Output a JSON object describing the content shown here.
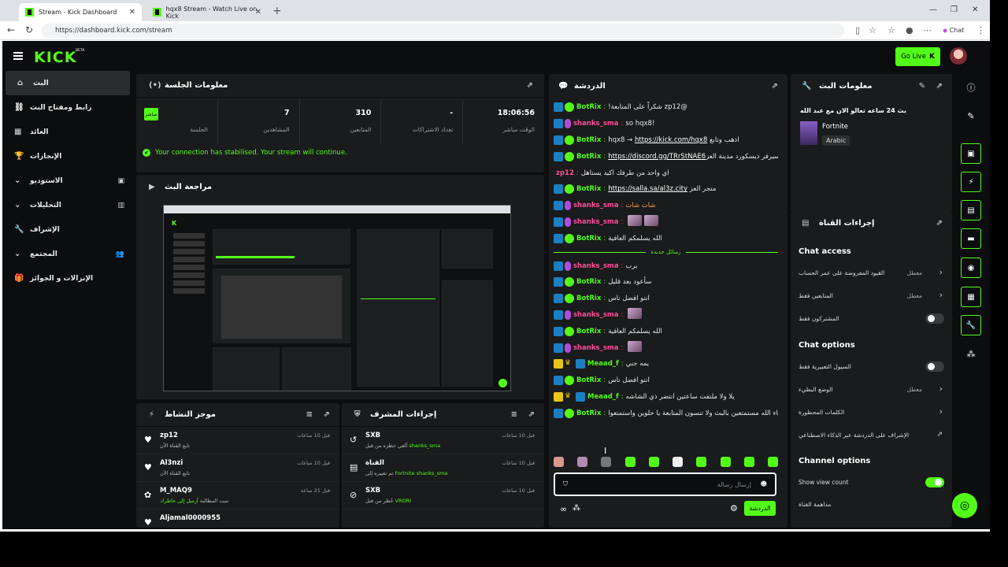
{
  "browser": {
    "tabs": [
      {
        "title": "Stream - Kick Dashboard",
        "active": true
      },
      {
        "title": "hqx8 Stream - Watch Live on Kick",
        "active": false
      }
    ],
    "url": "https://dashboard.kick.com/stream",
    "chat_label": "Chat"
  },
  "app": {
    "logo": "KICK",
    "logo_badge": "BETA",
    "go_live": "Go Live"
  },
  "sidebar": {
    "items": [
      {
        "label": "البث",
        "icon": "house-icon",
        "active": true
      },
      {
        "label": "رابط ومفتاح البث",
        "icon": "link-icon"
      },
      {
        "label": "العائد",
        "icon": "chart-icon"
      },
      {
        "label": "الإنجازات",
        "icon": "trophy-icon"
      },
      {
        "label": "الاستوديو",
        "icon": "studio-icon",
        "expandable": true
      },
      {
        "label": "التحليلات",
        "icon": "analytics-icon",
        "expandable": true
      },
      {
        "label": "الإشراف",
        "icon": "wrench-icon"
      },
      {
        "label": "المجتمع",
        "icon": "community-icon",
        "expandable": true
      },
      {
        "label": "الإنزالات و الجوائز",
        "icon": "gift-icon"
      }
    ]
  },
  "session": {
    "title": "معلومات الجلسة",
    "live_badge": "مباشر",
    "stats": [
      {
        "value": "",
        "label": "الجلسة"
      },
      {
        "value": "7",
        "label": "المشاهدين"
      },
      {
        "value": "310",
        "label": "المتابعين"
      },
      {
        "value": "-",
        "label": "تعداد الاشتراكات"
      },
      {
        "value": "18:06:56",
        "label": "الوقت مباشر"
      }
    ],
    "status_message": "Your connection has stabilised. Your stream will continue."
  },
  "preview": {
    "title": "مراجعة البث"
  },
  "activity": {
    "title": "موجز النشاط",
    "rows": [
      {
        "name": "zp12",
        "sub": "تابع القناة الآن",
        "time": "قبل 10 ساعات",
        "icon": "heart-icon"
      },
      {
        "name": "Al3nzi",
        "sub": "تابع القناة الآن",
        "time": "قبل 10 ساعات",
        "icon": "heart-icon"
      },
      {
        "name": "M_MAQ9",
        "sub": "أرسل إلى خاطرك",
        "time": "قبل 21 ساعة",
        "icon": "gift-icon",
        "sub_prefix": "تمت المطالبة"
      },
      {
        "name": "Aljamal0000955",
        "sub": "",
        "time": "",
        "icon": "heart-icon"
      }
    ]
  },
  "modlog": {
    "title": "إجراءات المشرف",
    "rows": [
      {
        "name": "SXB",
        "sub_user": "shanks_sma",
        "sub": "ألغي حظره من قبل",
        "time": "قبل 10 ساعات",
        "icon": "undo-icon"
      },
      {
        "name": "القناة",
        "sub_user": "shanks_sma",
        "sub_mid": "Fortnite",
        "sub": "تم تغييره إلى",
        "time": "قبل 10 ساعات",
        "icon": "channel-icon"
      },
      {
        "name": "SXB",
        "sub_user": "VRORI",
        "sub": "حُظر من قبل",
        "time": "قبل 10 ساعات",
        "icon": "ban-icon"
      }
    ]
  },
  "chat": {
    "title": "الدردشة",
    "new_messages_label": "رسائل جديدة",
    "messages": [
      {
        "user": "BotRix",
        "color": "green",
        "badges": [
          "bot",
          "ver"
        ],
        "text": "@zp12 شكراً على المتابعة!"
      },
      {
        "user": "shanks_sma",
        "color": "pink",
        "badges": [
          "bot",
          "mic"
        ],
        "text": "!so hqx8"
      },
      {
        "user": "BotRix",
        "color": "green",
        "badges": [
          "bot",
          "ver"
        ],
        "text": "اذهب وتابع hqx8 → ",
        "link": "https://kick.com/hqx8"
      },
      {
        "user": "BotRix",
        "color": "green",
        "badges": [
          "bot",
          "ver"
        ],
        "text": " سيرفر ديسكورد مدينة العز",
        "link": "https://discord.gg/TRrStNAE6"
      },
      {
        "user": "zp12",
        "color": "pink",
        "badges": [],
        "text": "اي واحد من طرفك اكيد يستاهل"
      },
      {
        "user": "BotRix",
        "color": "green",
        "badges": [
          "bot",
          "ver"
        ],
        "text": "متجر العز ",
        "link": "https://salla.sa/al3z.city"
      },
      {
        "user": "shanks_sma",
        "color": "pink",
        "badges": [
          "bot",
          "mic"
        ],
        "text": "شات شات",
        "orange": true
      },
      {
        "user": "shanks_sma",
        "color": "pink",
        "badges": [
          "bot",
          "mic"
        ],
        "text": "",
        "emotes": 2
      },
      {
        "user": "BotRix",
        "color": "green",
        "badges": [
          "bot",
          "ver"
        ],
        "text": "الله يسلمكم العافية"
      },
      {
        "divider": true
      },
      {
        "user": "shanks_sma",
        "color": "pink",
        "badges": [
          "bot",
          "mic"
        ],
        "text": "برب"
      },
      {
        "user": "BotRix",
        "color": "green",
        "badges": [
          "bot",
          "ver"
        ],
        "text": "سأعود بعد قليل"
      },
      {
        "user": "BotRix",
        "color": "green",
        "badges": [
          "bot",
          "ver"
        ],
        "text": "انتو افضل ناس"
      },
      {
        "user": "shanks_sma",
        "color": "pink",
        "badges": [
          "bot",
          "mic"
        ],
        "text": "",
        "emotes": 1
      },
      {
        "user": "BotRix",
        "color": "green",
        "badges": [
          "bot",
          "ver"
        ],
        "text": "الله يسلمكم العافية"
      },
      {
        "user": "shanks_sma",
        "color": "pink",
        "badges": [
          "bot",
          "mic"
        ],
        "text": "",
        "emotes": 1
      },
      {
        "user": "Meaad_f",
        "color": "green",
        "badges": [
          "sub",
          "crown",
          "bot"
        ],
        "text": "يمه جني"
      },
      {
        "user": "BotRix",
        "color": "green",
        "badges": [
          "bot",
          "ver"
        ],
        "text": "انتو افضل ناس"
      },
      {
        "user": "Meaad_f",
        "color": "green",
        "badges": [
          "sub",
          "crown",
          "bot"
        ],
        "text": "يلا ولا ملتفت ساعتين انتضر ذي الشاشه"
      },
      {
        "user": "BotRix",
        "color": "green",
        "badges": [
          "bot",
          "ver"
        ],
        "text": "ان شاء الله مستمتعين بالبث ولا تنسون المتابعة يا حلوين واستمتعوا"
      }
    ],
    "input_placeholder": "إرسال رسالة",
    "send_label": "الدردشة"
  },
  "stream_info": {
    "title": "معلومات البث",
    "stream_title": "بث 24 ساعه تعالو الان مع عبد الله",
    "category": "Fortnite",
    "language": "Arabic"
  },
  "channel_actions": {
    "title": "إجراءات القناة",
    "chat_access": {
      "heading": "Chat access",
      "rows": [
        {
          "label": "القيود المفروضة على عمر الحساب",
          "value": "معطل",
          "type": "chevron"
        },
        {
          "label": "المتابعين فقط",
          "value": "معطل",
          "type": "chevron"
        },
        {
          "label": "المشتركون فقط",
          "value": "",
          "type": "toggle",
          "on": false
        }
      ]
    },
    "chat_options": {
      "heading": "Chat options",
      "rows": [
        {
          "label": "السيول التعبيرية فقط",
          "value": "",
          "type": "toggle",
          "on": false
        },
        {
          "label": "الوضع البطيء",
          "value": "معطل",
          "type": "chevron"
        },
        {
          "label": "الكلمات المحظورة",
          "value": "",
          "type": "chevron"
        },
        {
          "label": "الإشراف على الدردشة عبر الذكاء الاصطناعي",
          "value": "",
          "type": "external"
        }
      ]
    },
    "channel_options": {
      "heading": "Channel options",
      "rows": [
        {
          "label": "Show view count",
          "value": "",
          "type": "toggle",
          "on": true
        },
        {
          "label": "مداهمة القناة",
          "value": "",
          "type": "none"
        }
      ]
    }
  },
  "colors": {
    "accent": "#53fc18",
    "bg": "#0b0d0e",
    "panel": "#191b1c",
    "pink": "#ff4d9a"
  }
}
